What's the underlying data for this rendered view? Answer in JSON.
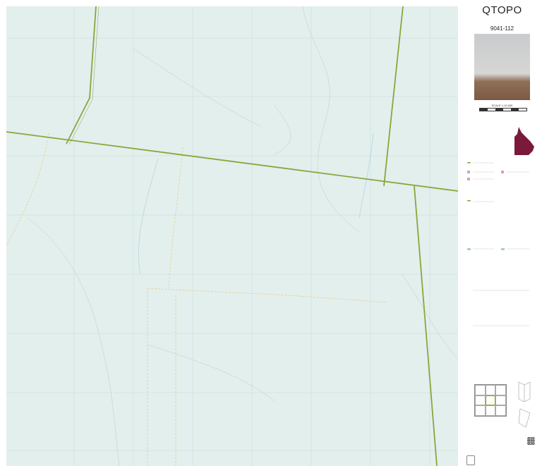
{
  "map": {
    "title": "QTOPO",
    "sheet_number": "9041-112",
    "scale": "SCALE 1:10,000"
  },
  "colors": {
    "map_background": "#e2efed",
    "road_green": "#8aa63a",
    "contour": "#c7c7c7",
    "dashed_track": "#e8c884",
    "watercourse": "#a9cbe0",
    "qld_inset": "#7a1a3a"
  }
}
